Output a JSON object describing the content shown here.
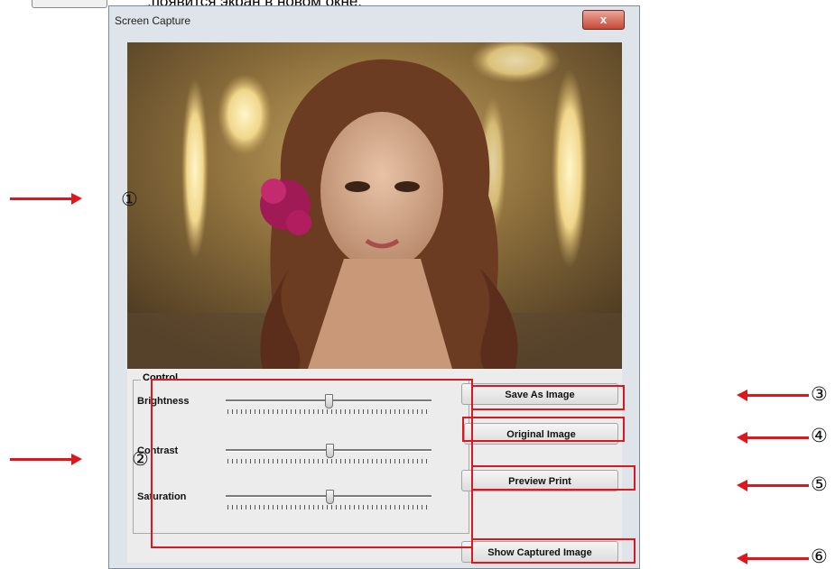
{
  "instruction_text": ",появится экран в новом окне.",
  "window": {
    "title": "Screen Capture",
    "close_glyph": "x"
  },
  "control": {
    "group_label": "Control",
    "sliders": [
      {
        "label": "Brightness",
        "value_fraction": 0.5
      },
      {
        "label": "Contrast",
        "value_fraction": 0.5
      },
      {
        "label": "Saturation",
        "value_fraction": 0.5
      }
    ]
  },
  "buttons": {
    "save_as_image": "Save As Image",
    "original_image": "Original Image",
    "preview_print": "Preview Print",
    "show_captured_image": "Show Captured Image"
  },
  "annotations": {
    "markers": [
      "①",
      "②",
      "③",
      "④",
      "⑤",
      "⑥"
    ],
    "color": "#e0161c"
  }
}
